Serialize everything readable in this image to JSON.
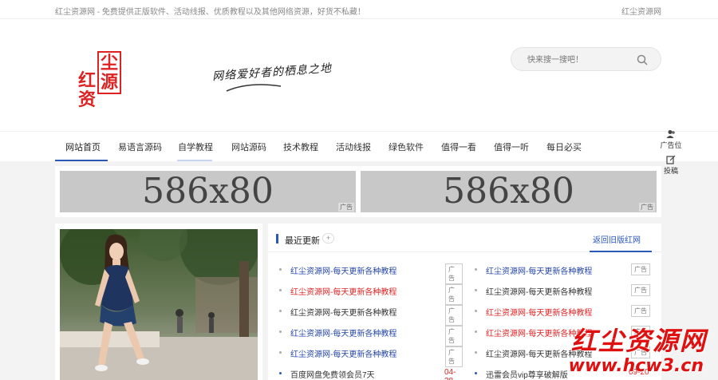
{
  "topbar": {
    "notice": "红尘资源网 - 免费提供正版软件、活动线报、优质教程以及其他网络资源，好货不私藏！",
    "site_link": "红尘资源网"
  },
  "header": {
    "logo_chars": [
      "红",
      "尘",
      "资",
      "源"
    ],
    "slogan": "网络爱好者的栖息之地",
    "search": {
      "placeholder": "快来搜一搜吧！",
      "icon": "search-icon"
    }
  },
  "nav": {
    "items": [
      "网站首页",
      "易语言源码",
      "自学教程",
      "网站源码",
      "技术教程",
      "活动线报",
      "绿色软件",
      "值得一看",
      "值得一听",
      "每日必买"
    ]
  },
  "side_buttons": [
    {
      "label": "广告位",
      "icon": "user-group-icon"
    },
    {
      "label": "投稿",
      "icon": "edit-icon"
    }
  ],
  "ads": [
    {
      "size": "586x80",
      "tag": "广告"
    },
    {
      "size": "586x80",
      "tag": "广告"
    }
  ],
  "panel": {
    "title": "最近更新",
    "plus": "+",
    "old_site": "返回旧版红网",
    "left_list": [
      {
        "text": "红尘资源网-每天更新各种教程",
        "badge": "广告",
        "color": "blue"
      },
      {
        "text": "红尘资源网-每天更新各种教程",
        "badge": "广告",
        "color": "red"
      },
      {
        "text": "红尘资源网-每天更新各种教程",
        "badge": "广告",
        "color": "dark"
      },
      {
        "text": "红尘资源网-每天更新各种教程",
        "badge": "广告",
        "color": "blue"
      },
      {
        "text": "红尘资源网-每天更新各种教程",
        "badge": "广告",
        "color": "blue"
      },
      {
        "text": "百度网盘免费领会员7天",
        "date": "04-28",
        "color": "dark"
      }
    ],
    "right_list": [
      {
        "text": "红尘资源网-每天更新各种教程",
        "badge": "广告",
        "color": "blue"
      },
      {
        "text": "红尘资源网-每天更新各种教程",
        "badge": "广告",
        "color": "dark"
      },
      {
        "text": "红尘资源网-每天更新各种教程",
        "badge": "广告",
        "color": "red"
      },
      {
        "text": "红尘资源网-每天更新各种教程",
        "badge": "广告",
        "color": "red"
      },
      {
        "text": "红尘资源网-每天更新各种教程",
        "badge": "广告",
        "color": "dark"
      },
      {
        "text": "迅雷会员vip尊享破解版",
        "date": "09-20",
        "color": "dark"
      }
    ]
  },
  "watermark": {
    "name": "红尘资源网",
    "url": "www.hcw3.cn"
  },
  "colors": {
    "accent": "#2b57b7",
    "red": "#e02222",
    "link_blue": "#2446a8"
  }
}
